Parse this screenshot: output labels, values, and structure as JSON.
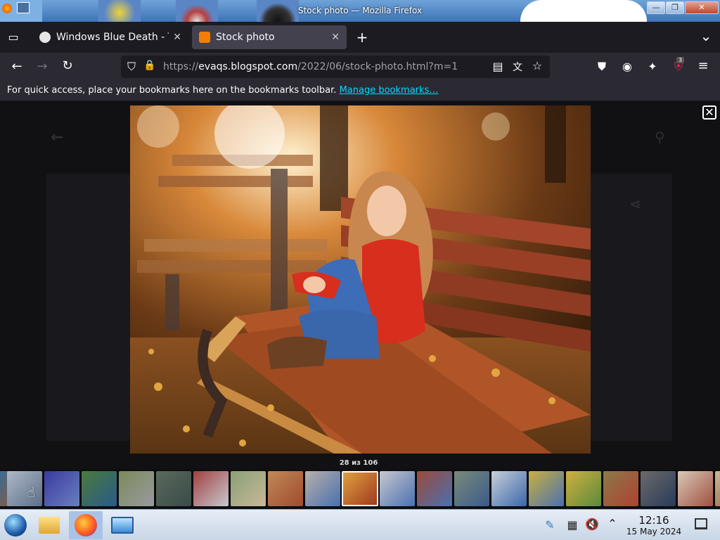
{
  "window": {
    "title": "Stock photo — Mozilla Firefox",
    "minimize_label": "—",
    "maximize_label": "❐",
    "close_label": "✕"
  },
  "tabs": [
    {
      "label": "Windows Blue Death - Te",
      "close": "✕",
      "active": false
    },
    {
      "label": "Stock photo",
      "close": "✕",
      "active": true
    }
  ],
  "toolbar": {
    "new_tab": "+",
    "tab_list": "⌄",
    "back": "←",
    "forward": "→",
    "reload": "↻"
  },
  "url": {
    "prefix": "https://",
    "host": "evaqs.blogspot.com",
    "path": "/2022/06/stock-photo.html?m=1"
  },
  "extensions_badge": "3",
  "bookmarks_bar": {
    "message": "For quick access, place your bookmarks here on the bookmarks toolbar.",
    "link": "Manage bookmarks…"
  },
  "lightbox": {
    "close": "✕",
    "counter": "28 из 106",
    "current_index": 28,
    "total": 106
  },
  "taskbar": {
    "time": "12:16",
    "date": "15 May 2024"
  },
  "colors": {
    "accent": "#00ddff",
    "tab_active": "#42414d",
    "toolbar": "#2b2a33"
  }
}
